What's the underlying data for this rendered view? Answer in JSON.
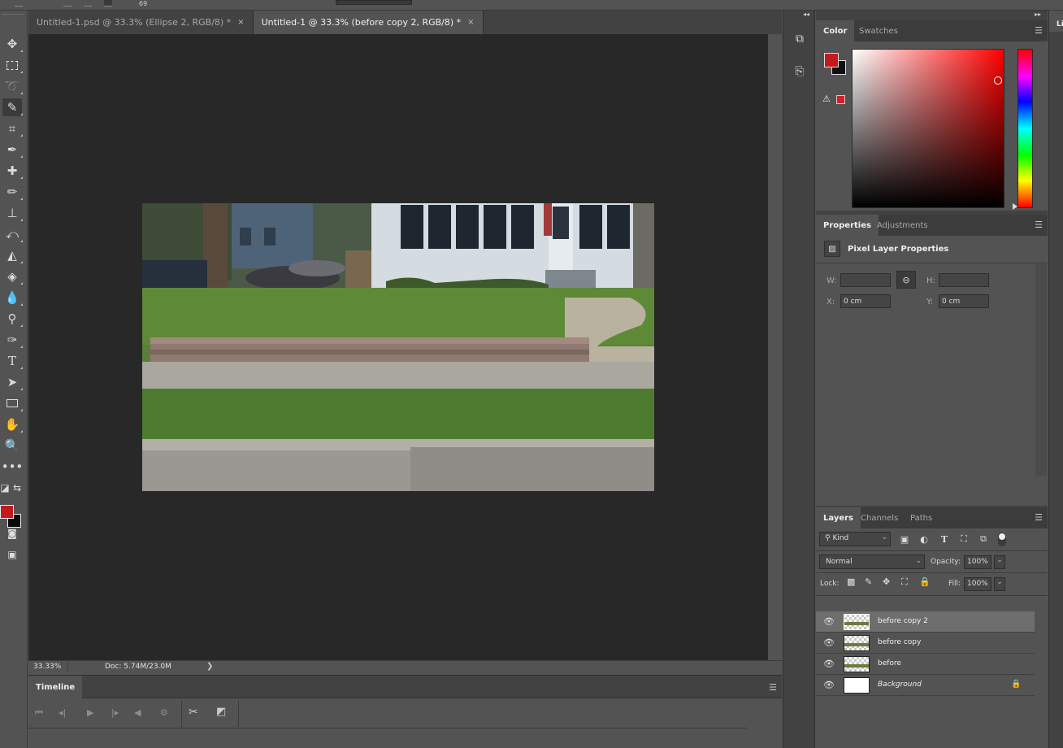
{
  "options_bar": {
    "brush_size": "69"
  },
  "tabs": [
    {
      "label": "Untitled-1.psd @ 33.3% (Ellipse 2, RGB/8) *",
      "close": "×"
    },
    {
      "label": "Untitled-1 @ 33.3% (before copy 2, RGB/8) *",
      "close": "×"
    }
  ],
  "status": {
    "zoom": "33.33%",
    "doc": "Doc: 5.74M/23.0M",
    "arrow": "❯"
  },
  "timeline": {
    "title": "Timeline",
    "menu_icon": "hamburger-menu-icon"
  },
  "color_panel": {
    "tabs": [
      "Color",
      "Swatches"
    ],
    "foreground": "#c31a1e",
    "background": "#111111"
  },
  "properties_panel": {
    "tabs": [
      "Properties",
      "Adjustments"
    ],
    "title": "Pixel Layer Properties",
    "w_label": "W:",
    "w_value": "",
    "h_label": "H:",
    "h_value": "",
    "x_label": "X:",
    "x_value": "0 cm",
    "y_label": "Y:",
    "y_value": "0 cm"
  },
  "layers_panel": {
    "tabs": [
      "Layers",
      "Channels",
      "Paths"
    ],
    "filter": "Kind",
    "blend_mode": "Normal",
    "opacity_label": "Opacity:",
    "opacity": "100%",
    "lock_label": "Lock:",
    "fill_label": "Fill:",
    "fill": "100%",
    "layers": [
      {
        "name": "before copy 2",
        "selected": true
      },
      {
        "name": "before copy",
        "selected": false
      },
      {
        "name": "before",
        "selected": false
      },
      {
        "name": "Background",
        "selected": false,
        "locked": true
      }
    ]
  },
  "far_panel": {
    "tab_stub": "Li"
  },
  "icons": {
    "tools": [
      "move-icon",
      "marquee-icon",
      "lasso-icon",
      "quick-selection-icon",
      "crop-icon",
      "eyedropper-icon",
      "healing-brush-icon",
      "brush-icon",
      "clone-stamp-icon",
      "history-brush-icon",
      "eraser-icon",
      "paint-bucket-icon",
      "blur-icon",
      "dodge-icon",
      "pen-icon",
      "type-icon",
      "path-selection-icon",
      "rectangle-icon",
      "hand-icon",
      "zoom-icon",
      "more-tools-icon"
    ]
  },
  "colors": {
    "accent_red": "#c31a1e",
    "canvas_bg": "#282828",
    "ui_bg": "#535353"
  }
}
